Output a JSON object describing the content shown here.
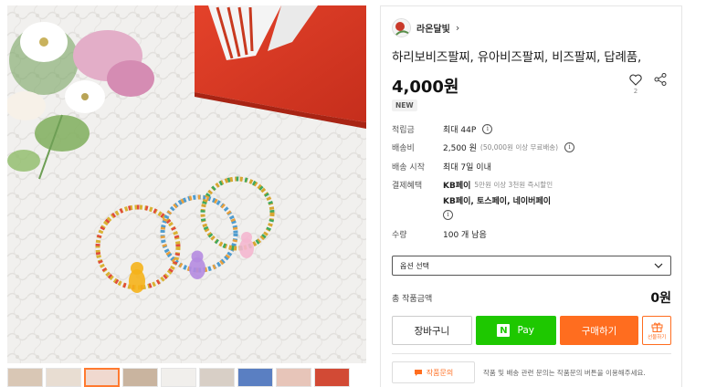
{
  "product": {
    "shop_name": "라온달빛",
    "title": "하리보비즈팔찌, 유아비즈팔찌, 비즈팔찌, 답례품,",
    "price": "4,000원",
    "favorite_count": "2",
    "badge": "NEW"
  },
  "details": {
    "points_label": "적립금",
    "points_value": "최대 44P",
    "shipping_label": "배송비",
    "shipping_value": "2,500 원",
    "shipping_note": "(50,000원 이상 무료배송)",
    "ship_start_label": "배송 시작",
    "ship_start_value": "최대 7일 이내",
    "payment_label": "결제혜택",
    "payment_kb": "KB페이",
    "payment_kb_note": "5만원 이상 3천원 즉시할인",
    "payment_methods": "KB페이, 토스페이, 네이버페이",
    "quantity_label": "수량",
    "quantity_value": "100 개 남음"
  },
  "option_select": {
    "label": "옵션 선택"
  },
  "total": {
    "label": "총 작품금액",
    "value": "0원"
  },
  "actions": {
    "cart": "장바구니",
    "naver_pay_logo": "N",
    "naver_pay": "Pay",
    "buy": "구매하기",
    "gift": "선물하기"
  },
  "qna": {
    "button": "작품문의",
    "note": "작품 및 배송 관련 문의는 작품문의 버튼을 이용해주세요."
  },
  "icons": {
    "chevron": "chevron-right-icon",
    "favorite": "heart-icon",
    "share": "share-icon",
    "info": "info-icon",
    "dropdown": "chevron-down-icon",
    "gift": "gift-icon",
    "chat": "chat-icon"
  },
  "colors": {
    "accent": "#ff6d1f",
    "naver_green": "#1ec800"
  },
  "thumbnails": [
    {
      "active": false
    },
    {
      "active": false
    },
    {
      "active": true
    },
    {
      "active": false
    },
    {
      "active": false
    },
    {
      "active": false
    },
    {
      "active": false
    },
    {
      "active": false
    },
    {
      "active": false
    }
  ]
}
